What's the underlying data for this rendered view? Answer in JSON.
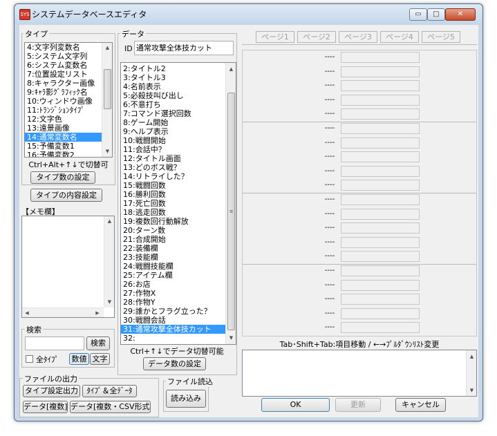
{
  "window": {
    "title": "システムデータベースエディタ",
    "app_icon": "SYS",
    "minimize_icon": "▭",
    "maximize_icon": "□",
    "close_icon": "✕"
  },
  "type_group": {
    "label": "タイプ",
    "items": [
      "4:文字列変数名",
      "5:システム文字列",
      "6:システム変数名",
      "7:位置設定リスト",
      "8:キャラクター画像",
      "9:ｷｬﾗ影ｸﾞﾗﾌｨｯｸ名",
      "10:ウィンドウ画像",
      "11:ﾄﾗﾝｼﾞｼｮﾝﾀｲﾌﾟ",
      "12:文字色",
      "13:遠景画像",
      "14:通常変数名",
      "15:予備変数1",
      "16:予備変数2"
    ],
    "selected_index": 10,
    "hint": "Ctrl+Alt+↑↓で切替可",
    "count_button": "タイプ数の設定",
    "content_button": "タイプの内容設定"
  },
  "memo": {
    "label": "【メモ欄】",
    "value": ""
  },
  "search": {
    "label": "検索",
    "value": "",
    "button": "検索",
    "all_types_label": "全ﾀｲﾌﾟ",
    "all_types_checked": false,
    "mode_numeric": "数値",
    "mode_text": "文字"
  },
  "file_output": {
    "label": "ファイルの出力",
    "type_settings_button": "タイプ設定出力",
    "type_all_data_button": "ﾀｲﾌﾟ＆全ﾃﾞｰﾀ",
    "data_multi_button": "データ[複数]",
    "data_csv_button": "データ[複数・CSV形式]"
  },
  "file_import": {
    "label": "ファイル読込",
    "button": "読み込み"
  },
  "data_group": {
    "label": "データ",
    "id_label": "ID",
    "id_value": "通常攻撃全体技カット",
    "items": [
      "2:タイトル2",
      "3:タイトル3",
      "4:名前表示",
      "5:必殺技叫び出し",
      "6:不意打ち",
      "7:コマンド選択回数",
      "8:ゲーム開始",
      "9:ヘルプ表示",
      "10:戦闘開始",
      "11:会話中？",
      "12:タイトル画面",
      "13:どのボス戦？",
      "14:リトライした？",
      "15:戦闘回数",
      "16:勝利回数",
      "17:死亡回数",
      "18:逃走回数",
      "19:複数回行動解放",
      "20:ターン数",
      "21:合成開始",
      "22:装備欄",
      "23:技能欄",
      "24:戦闘技能欄",
      "25:アイテム欄",
      "26:お店",
      "27:作物X",
      "28:作物Y",
      "29:誰かとフラグ立った？",
      "30:戦闘会話",
      "31:通常攻撃全体技カット",
      "32:"
    ],
    "selected_index": 29,
    "hint": "Ctrl+↑↓でデータ切替可能",
    "count_button": "データ数の設定"
  },
  "pages": {
    "tabs": [
      "ページ1",
      "ページ2",
      "ページ3",
      "ページ4",
      "ページ5"
    ],
    "row_placeholder": "----",
    "row_count": 20
  },
  "help_text": "Tab･Shift+Tab:項目移動 / ←→ﾌﾟﾙﾀﾞｳﾝﾘｽﾄ変更",
  "buttons": {
    "ok": "OK",
    "update": "更新",
    "cancel": "キャンセル"
  },
  "scroll_icons": {
    "up": "▲",
    "down": "▼",
    "left": "◀",
    "right": "▶",
    "grip": "≡"
  }
}
